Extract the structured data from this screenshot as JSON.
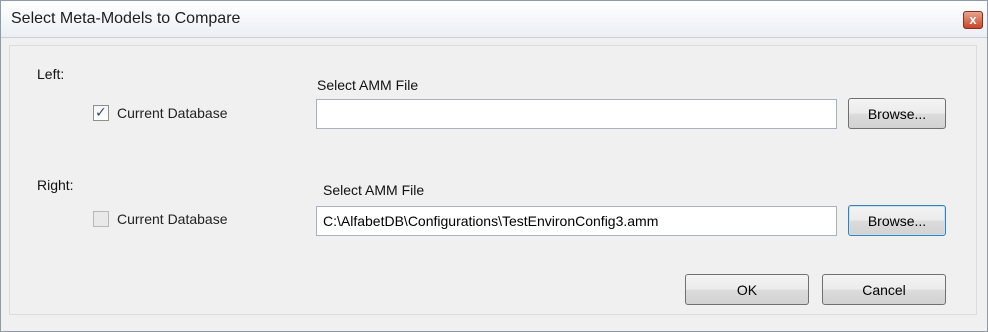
{
  "window": {
    "title": "Select Meta-Models to Compare",
    "close_label": "x"
  },
  "left": {
    "group_label": "Left:",
    "checkbox_label": "Current Database",
    "checkbox_checked": true,
    "file_label": "Select AMM File",
    "file_value": "",
    "browse_label": "Browse..."
  },
  "right": {
    "group_label": "Right:",
    "checkbox_label": "Current Database",
    "checkbox_checked": false,
    "file_label": "Select AMM File",
    "file_value": "C:\\AlfabetDB\\Configurations\\TestEnvironConfig3.amm",
    "browse_label": "Browse..."
  },
  "footer": {
    "ok_label": "OK",
    "cancel_label": "Cancel"
  },
  "colors": {
    "dialog_background": "#f0f0f0",
    "close_button": "#c7462a"
  }
}
